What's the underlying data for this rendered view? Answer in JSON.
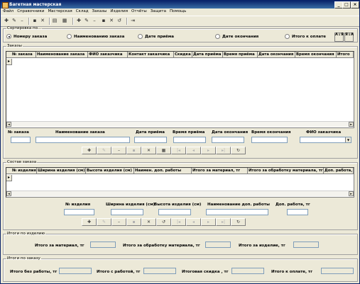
{
  "window": {
    "title": "Багетная мастерская",
    "min": "_",
    "max": "□",
    "close": "×"
  },
  "menu": [
    "Файл",
    "Справочники",
    "Мастерская",
    "Склад",
    "Заказы",
    "Изделия",
    "Отчёты",
    "Защита",
    "Помощь"
  ],
  "sort": {
    "legend": "Сортировка по…",
    "options": [
      "Номеру заказа",
      "Наименованию заказа",
      "Дате приёма",
      "Дате окончания",
      "Итого к оплате"
    ],
    "asc_label": "A↓Я",
    "desc_label": "Я↓A"
  },
  "orders": {
    "legend": "Заказы",
    "columns": [
      "№ заказа",
      "Наименование заказа",
      "ФИО заказчика",
      "Контакт заказчика",
      "Скидка",
      "Дата приёма",
      "Время приёма",
      "Дата окончания",
      "Время окончания",
      "Итого"
    ],
    "fields": [
      "№ заказа",
      "Наименование заказа",
      "Дата приёма",
      "Время приёма",
      "Дата окончания",
      "Время окончания",
      "ФИО заказчика"
    ]
  },
  "items": {
    "legend": "Состав заказа",
    "columns": [
      "№ изделия",
      "Ширина изделия (см)",
      "Высота изделия (см)",
      "Наимен. доп. работы",
      "Итого за материал, тг",
      "Итого за обработку материала, тг",
      "Доп. работа, тг"
    ],
    "fields": [
      "№ изделия",
      "Ширина изделия (см)",
      "Высота изделия (см)",
      "Наименование доп. работы",
      "Доп. работа, тг"
    ]
  },
  "item_totals": {
    "legend": "Итоги по изделию",
    "labels": [
      "Итого за материал, тг",
      "Итого за обработку материала, тг",
      "Итого за изделие, тг"
    ]
  },
  "order_totals": {
    "legend": "Итоги по заказу",
    "labels": [
      "Итого без работы, тг",
      "Итого с работой, тг",
      "Итоговая скидка , тг",
      "Итого к оплате, тг"
    ]
  },
  "nav_icons": [
    "plus-icon",
    "edit-icon",
    "minus-icon",
    "save-icon",
    "cancel-icon",
    "grid-icon",
    "first-icon",
    "prev-icon",
    "next-icon",
    "last-icon",
    "refresh-icon"
  ]
}
